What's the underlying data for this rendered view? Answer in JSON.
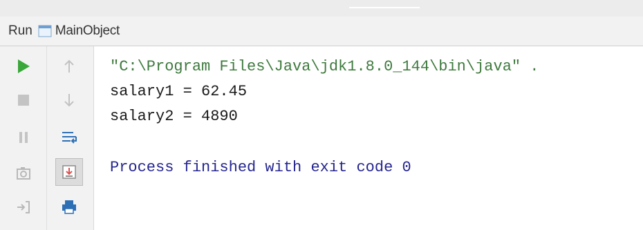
{
  "header": {
    "run_label": "Run",
    "config_name": "MainObject"
  },
  "console": {
    "command_line": "\"C:\\Program Files\\Java\\jdk1.8.0_144\\bin\\java\" .",
    "output": [
      "salary1 = 62.45",
      "salary2 = 4890"
    ],
    "exit_message": "Process finished with exit code 0"
  },
  "toolbar": {
    "left_icons": [
      "run-icon",
      "stop-icon",
      "pause-icon",
      "camera-icon",
      "exit-icon"
    ],
    "right_icons": [
      "arrow-up-icon",
      "arrow-down-icon",
      "soft-wrap-icon",
      "scroll-to-end-icon",
      "print-icon"
    ]
  },
  "colors": {
    "run_green": "#39a73a",
    "command_text": "#3e7a3e",
    "process_text": "#25258f",
    "output_text": "#1a1a1a",
    "panel_bg": "#f2f2f2"
  }
}
